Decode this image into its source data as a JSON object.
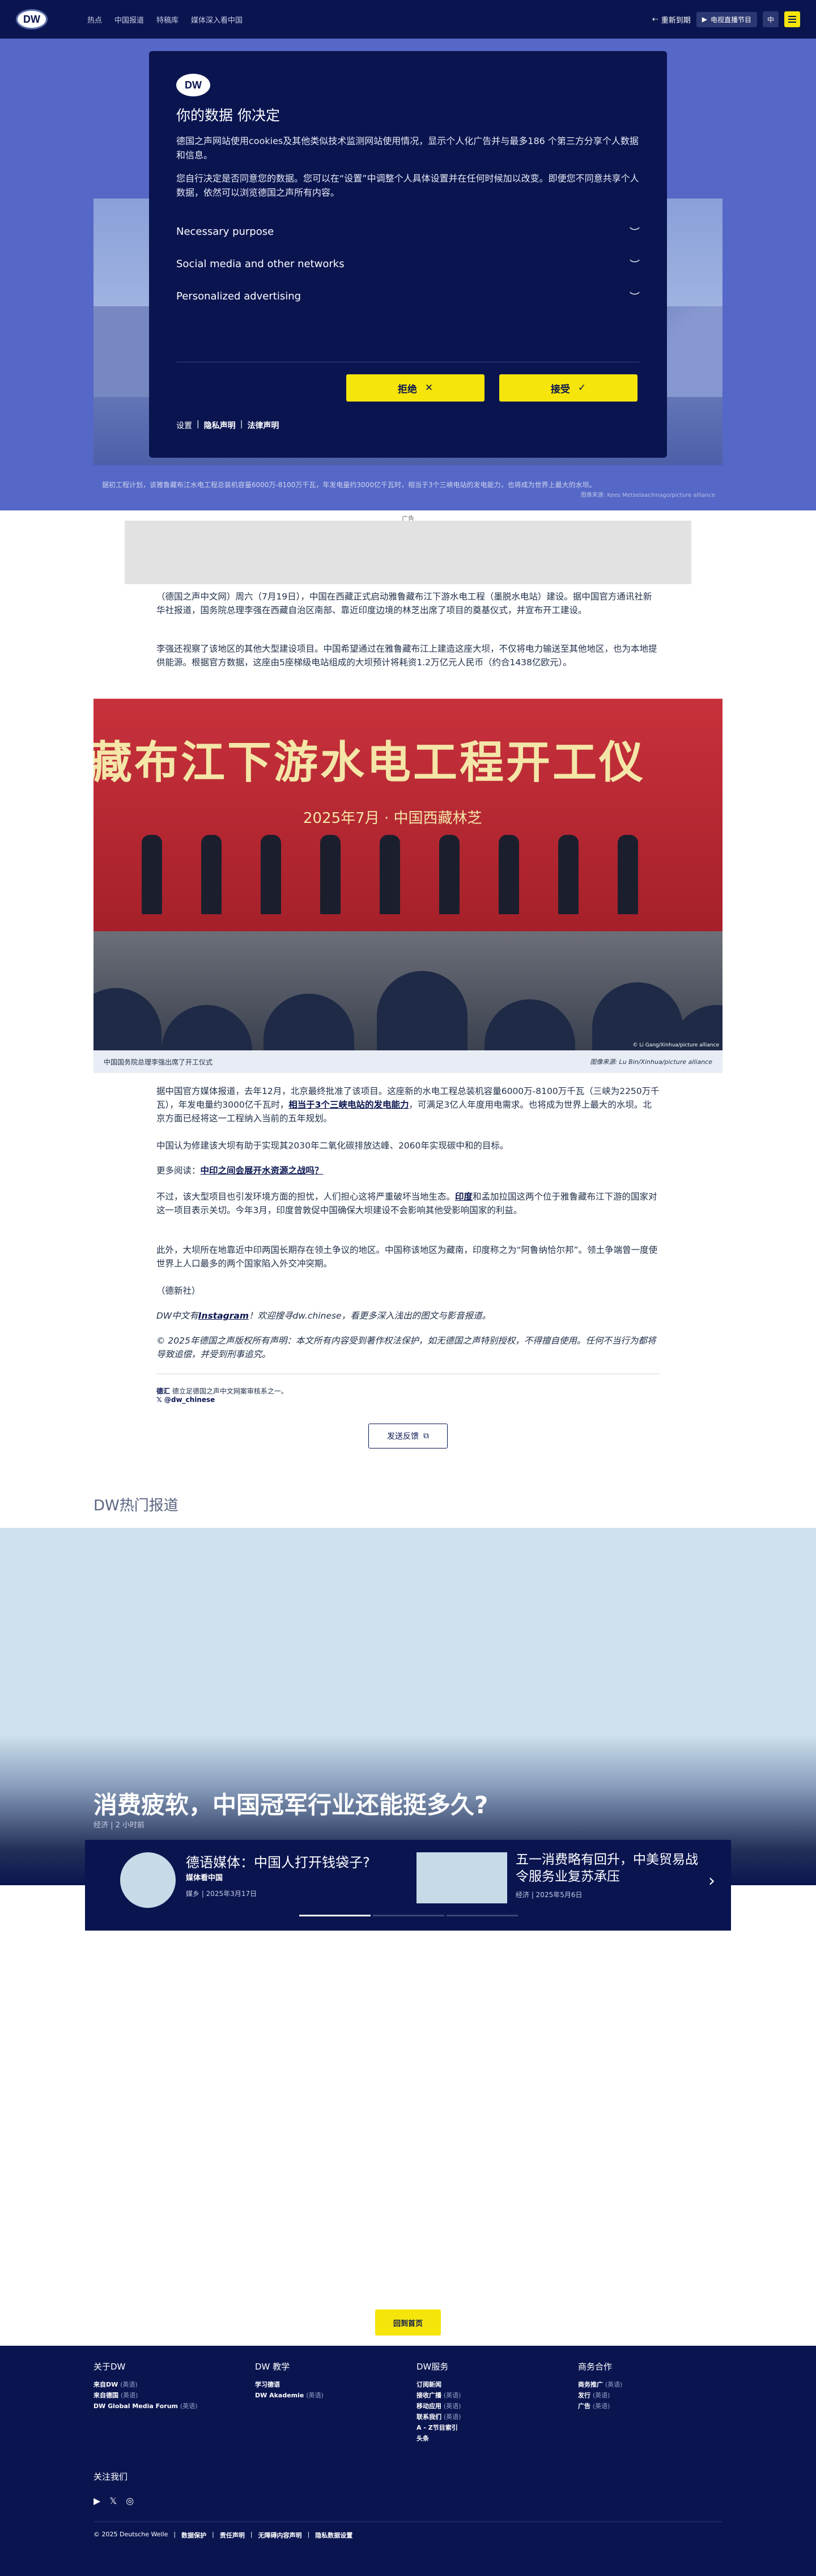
{
  "header": {
    "logo": "DW",
    "nav": [
      "热点",
      "中国报道",
      "特稿库",
      "媒体深入看中国"
    ],
    "login": "重新到期",
    "live": "电视直播节目",
    "lang": "中"
  },
  "hero": {
    "caption": "据初工程计划，该雅鲁藏布江水电工程总装机容量6000万-8100万千瓦，年发电量约3000亿千瓦时，相当于3个三峡电站的发电能力，也将成为世界上最大的水坝。",
    "credit": "图像来源: Kees Metselaar/Imago/picture alliance"
  },
  "cookie": {
    "logo": "DW",
    "title": "你的数据 你决定",
    "p1": "德国之声网站使用cookies及其他类似技术监测网站使用情况，显示个人化广告并与最多186 个第三方分享个人数据和信息。",
    "p2": "您自行决定是否同意您的数据。您可以在“设置”中调整个人具体设置并在任何时候加以改变。即便您不同意共享个人数据，依然可以浏览德国之声所有内容。",
    "sections": [
      "Necessary purpose",
      "Social media and other networks",
      "Personalized advertising"
    ],
    "reject": "拒绝",
    "accept": "接受",
    "settings": "设置",
    "privacy": "隐私声明",
    "legal": "法律声明"
  },
  "ad": {
    "label": "广告"
  },
  "article": {
    "p1": "（德国之声中文网）周六（7月19日），中国在西藏正式启动雅鲁藏布江下游水电工程（墨脱水电站）建设。据中国官方通讯社新华社报道，国务院总理李强在西藏自治区南部、靠近印度边境的林芝出席了项目的奠基仪式，并宣布开工建设。",
    "p2": "李强还视察了该地区的其他大型建设项目。中国希望通过在雅鲁藏布江上建造这座大坝，不仅将电力输送至其他地区，也为本地提供能源。根据官方数据，这座由5座梯级电站组成的大坝预计将耗资1.2万亿元人民币（约合1438亿欧元）。",
    "image_big": "藏布江下游水电工程开工仪",
    "image_sub": "2025年7月 · 中国西藏林芝",
    "image_overlay": "© Li Gang/Xinhua/picture alliance",
    "image_caption": "中国国务院总理李强出席了开工仪式",
    "image_credit": "图像来源: Lu Bin/Xinhua/picture alliance",
    "p3": "据中国官方媒体报道，去年12月，北京最终批准了该项目。这座新的水电工程总装机容量6000万-8100万千瓦（三峡为2250万千瓦），年发电量约3000亿千瓦时，",
    "p3_link": "相当于3个三峡电站的发电能力",
    "p3_end": "，可满足3亿人年度用电需求。也将成为世界上最大的水坝。北京方面已经将这一工程纳入当前的五年规划。",
    "p4": "中国认为修建该大坝有助于实现其2030年二氧化碳排放达峰、2060年实现碳中和的目标。",
    "more_label": "更多阅读：",
    "more_link": "中印之间会展开水资源之战吗？",
    "p5a": "不过，该大型项目也引发环境方面的担忧，人们担心这将严重破坏当地生态。",
    "p5_bold": "印度",
    "p5b": "和孟加拉国这两个位于雅鲁藏布江下游的国家对这一项目表示关切。今年3月，印度曾敦促中国确保大坝建设不会影响其他受影响国家的利益。",
    "p6": "此外，大坝所在地靠近中印两国长期存在领土争议的地区。中国称该地区为藏南，印度称之为“阿鲁纳恰尔邦”。领土争端曾一度使世界上人口最多的两个国家陷入外交冲突期。",
    "p7": "（德新社）",
    "ig_pre": "DW中文有",
    "ig_link": "Instagram",
    "ig_post": "！欢迎搜寻dw.chinese，看更多深入浅出的图文与影音报道。",
    "copyright": "© 2025年德国之声版权所有声明：本文所有内容受到著作权法保护，如无德国之声特别授权，不得擅自使用。任何不当行为都将导致追偿，并受到刑事追究。",
    "tag1_b": "德汇",
    "tag1": " 德立足德国之声中文网案审核系之一。",
    "tag2": "@dw_chinese",
    "feedback": "发送反馈"
  },
  "hot": {
    "title": "DW热门报道",
    "headline": "消费疲软，中国冠军行业还能挺多久?",
    "meta": "经济 | 2 小时前",
    "card1_title": "德语媒体：中国人打开钱袋子?",
    "card1_sub": "媒体看中国",
    "card1_meta": "媒乡 | 2025年3月17日",
    "card2_title": "五一消费略有回升，中美贸易战令服务业复苏承压",
    "card2_meta": "经济 | 2025年5月6日",
    "next": "›"
  },
  "back_top": "回到首页",
  "footer": {
    "col1_title": "关于DW",
    "col1": [
      [
        "来自DW",
        "(英语)"
      ],
      [
        "来自德国",
        "(英语)"
      ],
      [
        "DW Global Media Forum",
        "(英语)"
      ]
    ],
    "col2_title": "DW 教学",
    "col2": [
      [
        "学习德语",
        ""
      ],
      [
        "DW Akademie",
        "(英语)"
      ]
    ],
    "col3_title": "DW服务",
    "col3": [
      [
        "订阅新闻",
        ""
      ],
      [
        "接收广播",
        "(英语)"
      ],
      [
        "移动应用",
        "(英语)"
      ],
      [
        "联系我们",
        "(英语)"
      ],
      [
        "A - Z节目索引",
        ""
      ],
      [
        "头条",
        ""
      ]
    ],
    "col4_title": "商务合作",
    "col4": [
      [
        "商务推广",
        "(英语)"
      ],
      [
        "发行",
        "(英语)"
      ],
      [
        "广告",
        "(英语)"
      ]
    ],
    "follow": "关注我们",
    "social": [
      "▶",
      "𝕏",
      "◎"
    ],
    "copyright": "© 2025 Deutsche Welle",
    "legal": [
      "数据保护",
      "责任声明",
      "无障碍内容声明",
      "隐私数据设置"
    ]
  }
}
